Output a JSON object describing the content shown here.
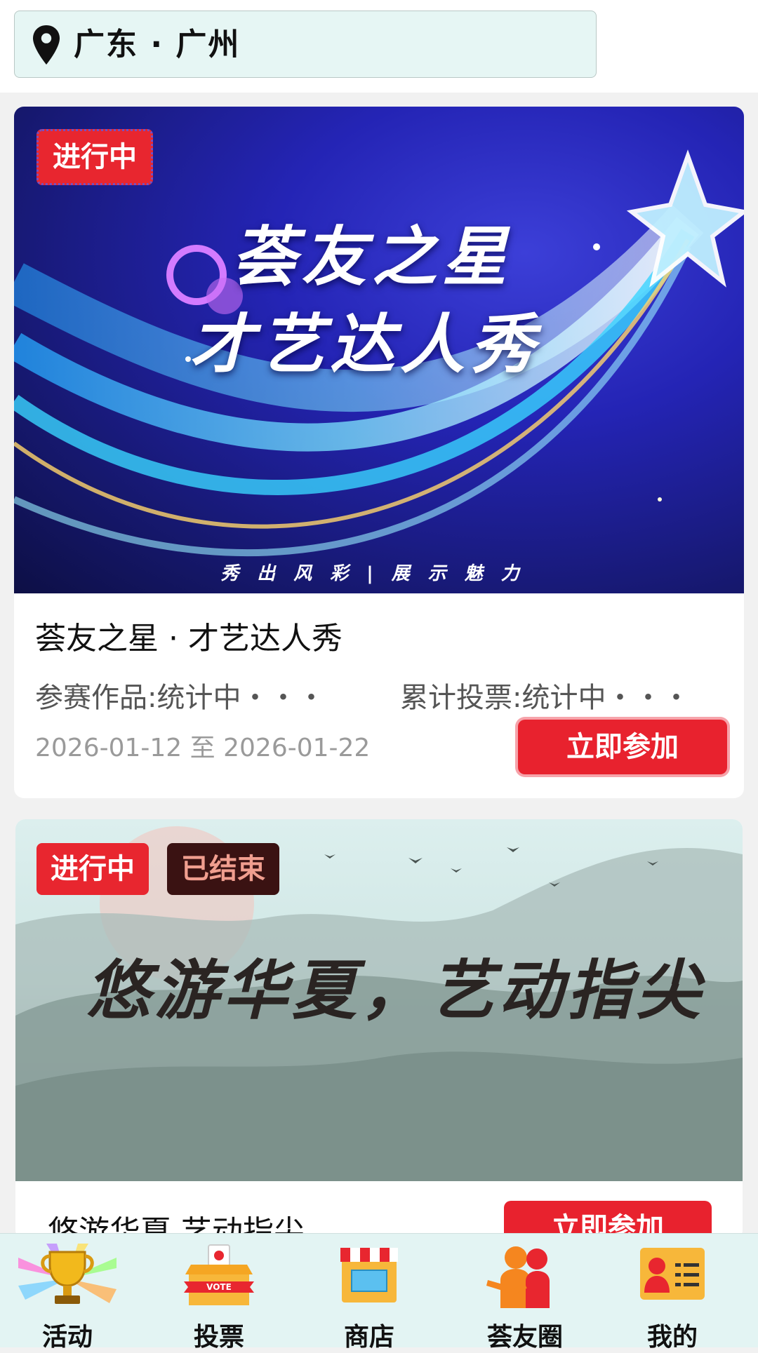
{
  "header": {
    "location": "广东 · 广州"
  },
  "activities": [
    {
      "badges": [
        "进行中"
      ],
      "banner_title_line1": "荟友之星",
      "banner_title_line2": "才艺达人秀",
      "banner_slogan": "秀出风彩|展示魅力",
      "title": "荟友之星 · 才艺达人秀",
      "works": "参赛作品:统计中・・・",
      "votes": "累计投票:统计中・・・",
      "dates": "2026-01-12 至 2026-01-22",
      "join_label": "立即参加"
    },
    {
      "badges": [
        "进行中",
        "已结束"
      ],
      "banner_title": "悠游华夏，艺动指尖",
      "title": "悠游华夏,艺动指尖",
      "join_label": "立即参加"
    }
  ],
  "tabbar": {
    "items": [
      {
        "label": "活动",
        "icon": "trophy-icon"
      },
      {
        "label": "投票",
        "icon": "vote-box-icon"
      },
      {
        "label": "商店",
        "icon": "shop-icon"
      },
      {
        "label": "荟友圈",
        "icon": "friends-icon"
      },
      {
        "label": "我的",
        "icon": "profile-card-icon"
      }
    ]
  },
  "colors": {
    "accent_red": "#e8222e",
    "tabbar_bg": "#e3f4f3",
    "location_bg": "#e6f6f4"
  }
}
